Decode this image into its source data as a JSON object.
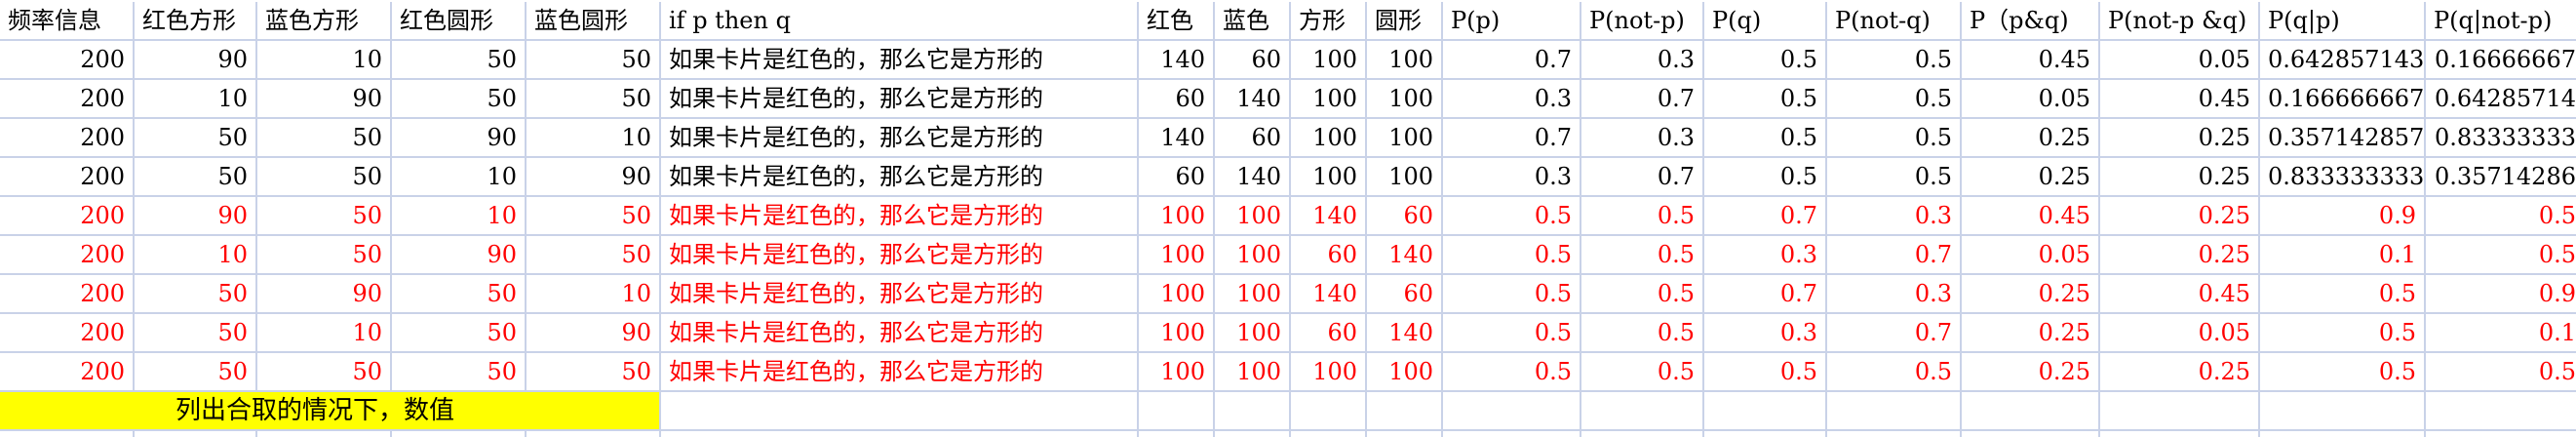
{
  "sheet": {
    "headers": [
      "频率信息",
      "红色方形",
      "蓝色方形",
      "红色圆形",
      "蓝色圆形",
      "if p then q",
      "红色",
      "蓝色",
      "方形",
      "圆形",
      "P(p)",
      "P(not-p)",
      "P(q)",
      "P(not-q)",
      "P（p&q)",
      "P(not-p &q)",
      "P(q|p)",
      "P(q|not-p)"
    ],
    "rows": [
      {
        "color": "black",
        "cells": [
          "200",
          "90",
          "10",
          "50",
          "50",
          "如果卡片是红色的，那么它是方形的",
          "140",
          "60",
          "100",
          "100",
          "0.7",
          "0.3",
          "0.5",
          "0.5",
          "0.45",
          "0.05",
          "0.642857143",
          "0.16666667"
        ]
      },
      {
        "color": "black",
        "cells": [
          "200",
          "10",
          "90",
          "50",
          "50",
          "如果卡片是红色的，那么它是方形的",
          "60",
          "140",
          "100",
          "100",
          "0.3",
          "0.7",
          "0.5",
          "0.5",
          "0.05",
          "0.45",
          "0.166666667",
          "0.64285714"
        ]
      },
      {
        "color": "black",
        "cells": [
          "200",
          "50",
          "50",
          "90",
          "10",
          "如果卡片是红色的，那么它是方形的",
          "140",
          "60",
          "100",
          "100",
          "0.7",
          "0.3",
          "0.5",
          "0.5",
          "0.25",
          "0.25",
          "0.357142857",
          "0.83333333"
        ]
      },
      {
        "color": "black",
        "cells": [
          "200",
          "50",
          "50",
          "10",
          "90",
          "如果卡片是红色的，那么它是方形的",
          "60",
          "140",
          "100",
          "100",
          "0.3",
          "0.7",
          "0.5",
          "0.5",
          "0.25",
          "0.25",
          "0.833333333",
          "0.35714286"
        ]
      },
      {
        "color": "red",
        "cells": [
          "200",
          "90",
          "50",
          "10",
          "50",
          "如果卡片是红色的，那么它是方形的",
          "100",
          "100",
          "140",
          "60",
          "0.5",
          "0.5",
          "0.7",
          "0.3",
          "0.45",
          "0.25",
          "0.9",
          "0.5"
        ]
      },
      {
        "color": "red",
        "cells": [
          "200",
          "10",
          "50",
          "90",
          "50",
          "如果卡片是红色的，那么它是方形的",
          "100",
          "100",
          "60",
          "140",
          "0.5",
          "0.5",
          "0.3",
          "0.7",
          "0.05",
          "0.25",
          "0.1",
          "0.5"
        ]
      },
      {
        "color": "red",
        "cells": [
          "200",
          "50",
          "90",
          "50",
          "10",
          "如果卡片是红色的，那么它是方形的",
          "100",
          "100",
          "140",
          "60",
          "0.5",
          "0.5",
          "0.7",
          "0.3",
          "0.25",
          "0.45",
          "0.5",
          "0.9"
        ]
      },
      {
        "color": "red",
        "cells": [
          "200",
          "50",
          "10",
          "50",
          "90",
          "如果卡片是红色的，那么它是方形的",
          "100",
          "100",
          "60",
          "140",
          "0.5",
          "0.5",
          "0.3",
          "0.7",
          "0.25",
          "0.05",
          "0.5",
          "0.1"
        ]
      },
      {
        "color": "red",
        "cells": [
          "200",
          "50",
          "50",
          "50",
          "50",
          "如果卡片是红色的，那么它是方形的",
          "100",
          "100",
          "100",
          "100",
          "0.5",
          "0.5",
          "0.5",
          "0.5",
          "0.25",
          "0.25",
          "0.5",
          "0.5"
        ]
      }
    ],
    "note": "列出合取的情况下，数值"
  }
}
